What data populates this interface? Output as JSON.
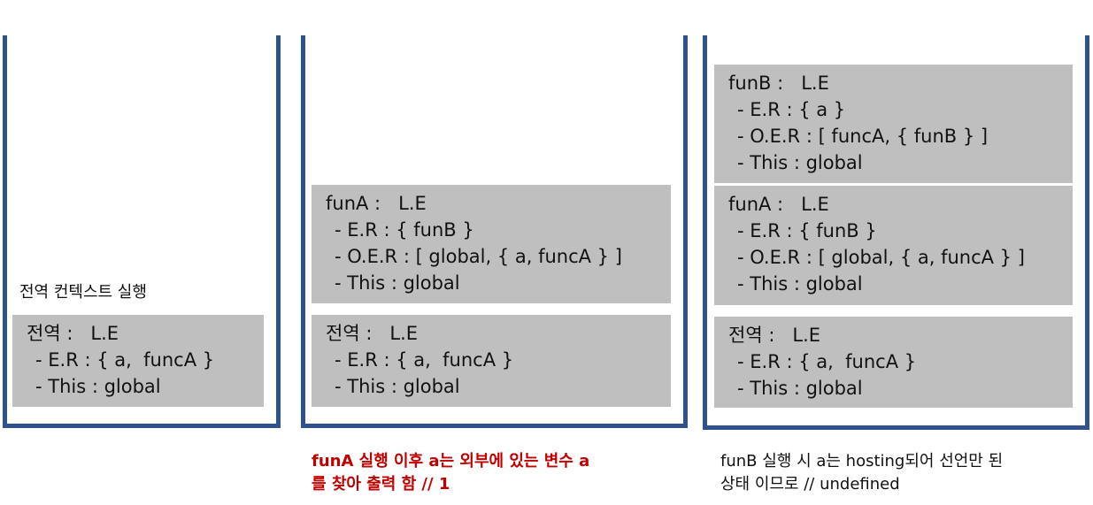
{
  "colors": {
    "stack_border": "#2f528f",
    "context_fill": "#bfbfbf",
    "highlight_text": "#c00000"
  },
  "stack1": {
    "label": "전역 컨텍스트 실행",
    "contexts": [
      {
        "title": "전역 :   L.E",
        "lines": [
          "- E.R : { a,  funcA }",
          "- This : global"
        ]
      }
    ]
  },
  "stack2": {
    "contexts": [
      {
        "title": "funA :   L.E",
        "lines": [
          "- E.R : { funB }",
          "- O.E.R : [ global, { a, funcA } ]",
          "- This : global"
        ]
      },
      {
        "title": "전역 :   L.E",
        "lines": [
          "- E.R : { a,  funcA }",
          "- This : global"
        ]
      }
    ],
    "caption": [
      "funA 실행 이후 a는 외부에 있는 변수 a",
      "를 찾아 출력 함 // 1"
    ]
  },
  "stack3": {
    "contexts": [
      {
        "title": "funB :   L.E",
        "lines": [
          "- E.R : { a }",
          "- O.E.R : [ funcA, { funB } ]",
          "- This : global"
        ]
      },
      {
        "title": "funA :   L.E",
        "lines": [
          "- E.R : { funB }",
          "- O.E.R : [ global, { a, funcA } ]",
          "- This : global"
        ]
      },
      {
        "title": "전역 :   L.E",
        "lines": [
          "- E.R : { a,  funcA }",
          "- This : global"
        ]
      }
    ],
    "caption": [
      "funB 실행 시 a는 hosting되어 선언만 된",
      "상태 이므로 // undefined"
    ]
  }
}
